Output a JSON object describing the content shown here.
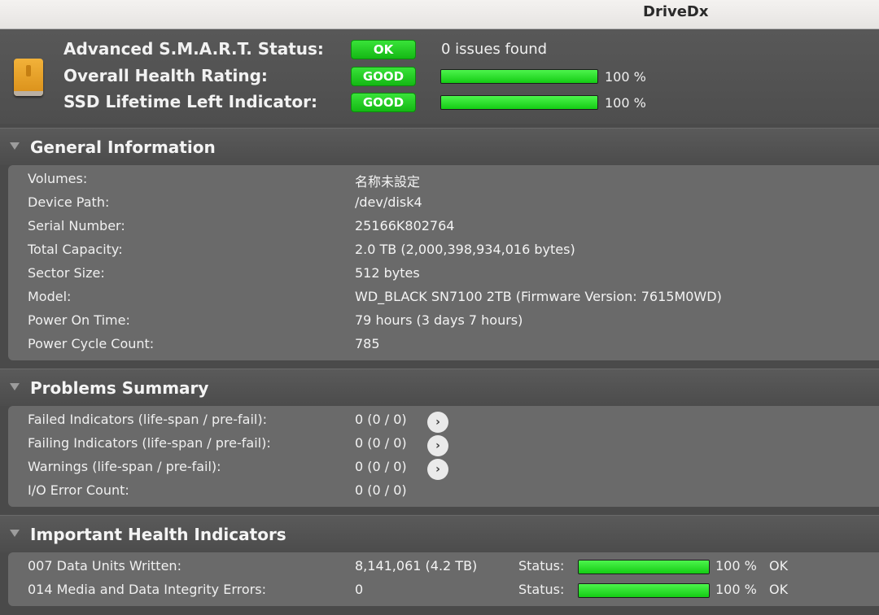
{
  "window": {
    "title": "DriveDx"
  },
  "header": {
    "rows": [
      {
        "label": "Advanced S.M.A.R.T. Status:",
        "badge": "OK",
        "value": "0 issues found"
      },
      {
        "label": "Overall Health Rating:",
        "badge": "GOOD",
        "percent": "100 %",
        "level": 1.0
      },
      {
        "label": "SSD Lifetime Left Indicator:",
        "badge": "GOOD",
        "percent": "100 %",
        "level": 1.0
      }
    ],
    "icon": "drive-icon",
    "badge_color": "#22cc22"
  },
  "general": {
    "title": "General Information",
    "rows": [
      {
        "label": "Volumes:",
        "value": "名称未設定"
      },
      {
        "label": "Device Path:",
        "value": "/dev/disk4"
      },
      {
        "label": "Serial Number:",
        "value": "25166K802764"
      },
      {
        "label": "Total Capacity:",
        "value": "2.0 TB (2,000,398,934,016 bytes)"
      },
      {
        "label": "Sector Size:",
        "value": "512 bytes"
      },
      {
        "label": "Model:",
        "value": "WD_BLACK SN7100 2TB  (Firmware Version: 7615M0WD)"
      },
      {
        "label": "Power On Time:",
        "value": "79 hours (3 days 7 hours)"
      },
      {
        "label": "Power Cycle Count:",
        "value": "785"
      }
    ]
  },
  "problems": {
    "title": "Problems Summary",
    "rows": [
      {
        "label": "Failed Indicators (life-span / pre-fail):",
        "value": "0 (0 / 0)",
        "arrow": "›"
      },
      {
        "label": "Failing Indicators (life-span / pre-fail):",
        "value": "0 (0 / 0)",
        "arrow": "›"
      },
      {
        "label": "Warnings (life-span / pre-fail):",
        "value": "0 (0 / 0)",
        "arrow": "›"
      },
      {
        "label": "I/O Error Count:",
        "value": "0 (0 / 0)"
      }
    ]
  },
  "health": {
    "title": "Important Health Indicators",
    "rows": [
      {
        "label": "007  Data Units Written:",
        "value": "8,141,061 (4.2 TB)",
        "status_label": "Status:",
        "percent": "100 %",
        "level": 1.0,
        "status": "OK"
      },
      {
        "label": "014  Media and Data Integrity Errors:",
        "value": "0",
        "status_label": "Status:",
        "percent": "100 %",
        "level": 1.0,
        "status": "OK"
      }
    ]
  }
}
